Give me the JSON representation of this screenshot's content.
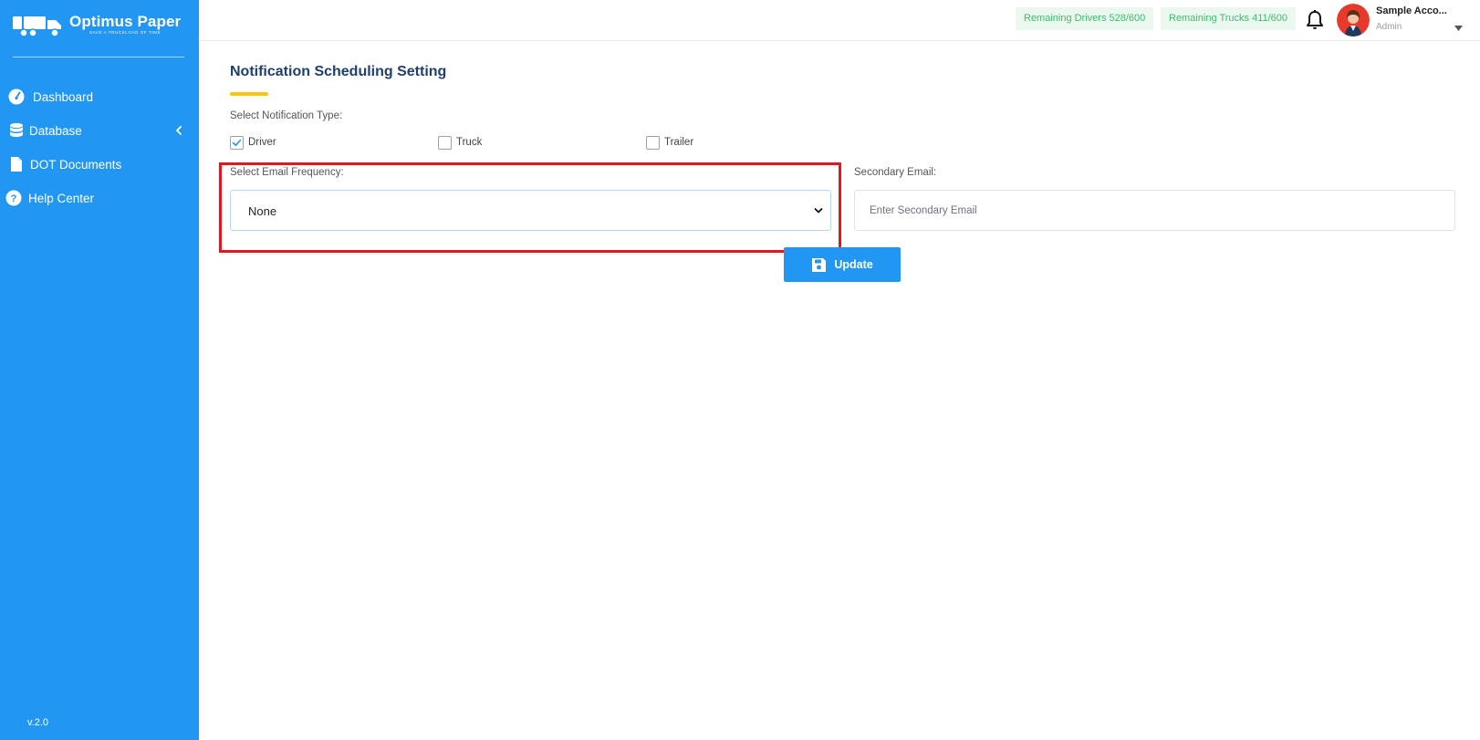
{
  "brand": {
    "name": "Optimus Paper",
    "tagline": "SAVE A TRUCKLOAD OF TIME",
    "logo_icon": "truck-logo-icon"
  },
  "sidebar": {
    "items": [
      {
        "label": "Dashboard",
        "icon": "gauge-icon"
      },
      {
        "label": "Database",
        "icon": "database-icon",
        "has_chevron": true
      },
      {
        "label": "DOT Documents",
        "icon": "document-icon"
      },
      {
        "label": "Help Center",
        "icon": "question-icon"
      }
    ],
    "version": "v.2.0"
  },
  "topbar": {
    "drivers_badge": "Remaining Drivers 528/600",
    "trucks_badge": "Remaining Trucks 411/600",
    "user_name": "Sample Acco...",
    "user_role": "Admin"
  },
  "page": {
    "title": "Notification Scheduling Setting",
    "notification_type_label": "Select Notification Type:",
    "notification_types": [
      {
        "label": "Driver",
        "checked": true
      },
      {
        "label": "Truck",
        "checked": false
      },
      {
        "label": "Trailer",
        "checked": false
      }
    ],
    "email_frequency_label": "Select Email Frequency:",
    "email_frequency_value": "None",
    "secondary_email_label": "Secondary Email:",
    "secondary_email_placeholder": "Enter Secondary Email",
    "secondary_email_value": "",
    "update_label": "Update"
  },
  "colors": {
    "sidebar_bg": "#2196f3",
    "title": "#1d3f72",
    "accent_bar": "#f9c710",
    "badge_bg": "#eaf8ef",
    "badge_text": "#3ebd6b",
    "highlight": "#e3171f"
  }
}
